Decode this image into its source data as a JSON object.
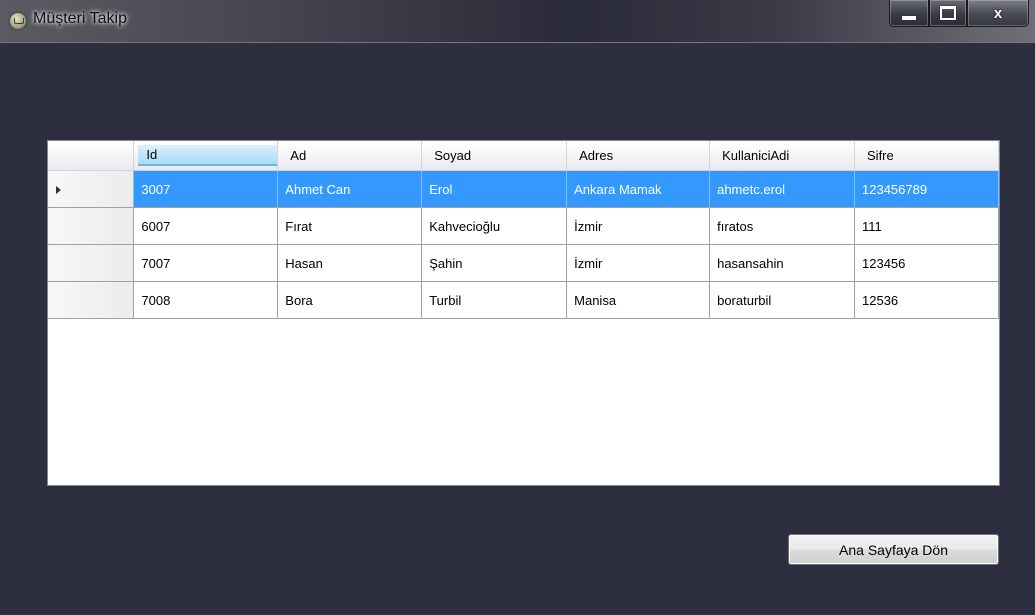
{
  "window": {
    "title": "Müşteri Takip",
    "icon": "cart-icon",
    "controls": {
      "minimize": "minimize-icon",
      "maximize": "maximize-icon",
      "close_label": "x"
    }
  },
  "grid": {
    "columns": [
      "Id",
      "Ad",
      "Soyad",
      "Adres",
      "KullaniciAdi",
      "Sifre"
    ],
    "sorted_column": "Id",
    "selected_row": 0,
    "rows": [
      [
        "3007",
        "Ahmet Can",
        "Erol",
        "Ankara Mamak",
        "ahmetc.erol",
        "123456789"
      ],
      [
        "6007",
        "Fırat",
        "Kahvecioğlu",
        "İzmir",
        "fıratos",
        "111"
      ],
      [
        "7007",
        "Hasan",
        "Şahin",
        "İzmir",
        "hasansahin",
        "123456"
      ],
      [
        "7008",
        "Bora",
        "Turbil",
        "Manisa",
        "boraturbil",
        "12536"
      ]
    ]
  },
  "actions": {
    "back_button_label": "Ana Sayfaya Dön"
  },
  "colors": {
    "window_background": "#2d2e3f",
    "selection": "#3399ff",
    "sorted_header": "#bfe5f9"
  }
}
